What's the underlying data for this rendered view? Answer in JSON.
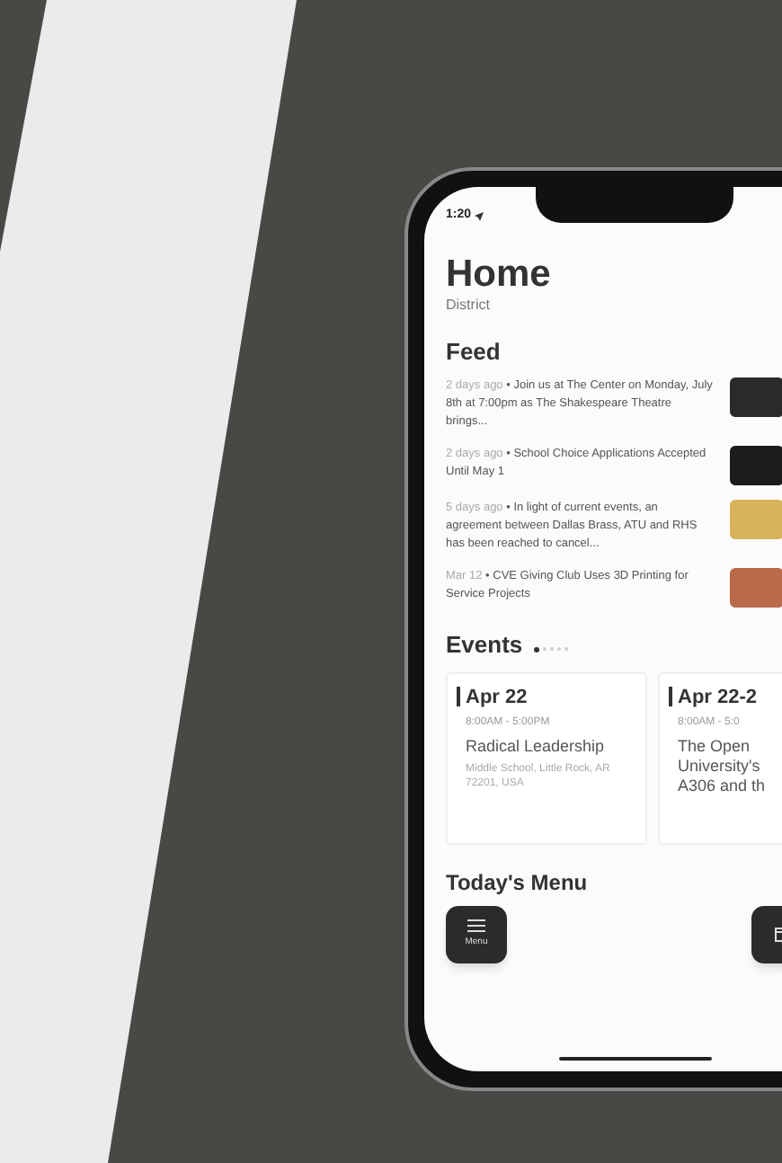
{
  "status_bar": {
    "time": "1:20"
  },
  "header": {
    "title": "Home",
    "subtitle": "District"
  },
  "feed": {
    "title": "Feed",
    "items": [
      {
        "when": "2 days ago",
        "text": "• Join us at The Center on Monday, July 8th at 7:00pm as The Shakespeare Theatre brings..."
      },
      {
        "when": "2 days ago",
        "text": "• School Choice Applications Accepted Until May 1"
      },
      {
        "when": "5 days ago",
        "text": "• In light of current events, an agreement between Dallas Brass, ATU and RHS has been reached to cancel..."
      },
      {
        "when": "Mar 12",
        "text": "• CVE Giving Club Uses 3D Printing for Service Projects"
      }
    ]
  },
  "events": {
    "title": "Events",
    "pages": [
      {
        "selected": true
      },
      {
        "selected": false
      },
      {
        "selected": false
      },
      {
        "selected": false
      },
      {
        "selected": false
      }
    ],
    "cards": [
      {
        "date": "Apr 22",
        "time": "8:00AM - 5:00PM",
        "name_lines": [
          "Radical Leadership"
        ],
        "place": "Middle School, Little Rock, AR 72201, USA"
      },
      {
        "date": "Apr 22-2",
        "time": "8:00AM - 5:0",
        "name_lines": [
          "The Open",
          "University's",
          "A306 and th"
        ]
      }
    ]
  },
  "menu": {
    "title": "Today's Menu"
  },
  "tab_bar": [
    {
      "kind": "menu",
      "label": "Menu"
    },
    {
      "kind": "calendar"
    }
  ]
}
